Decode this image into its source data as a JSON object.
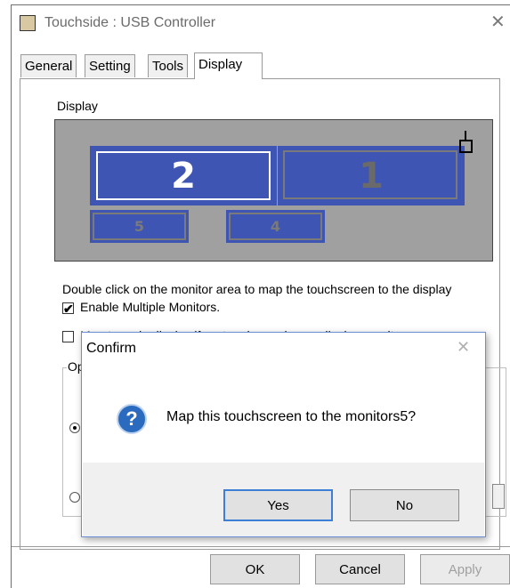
{
  "window": {
    "title": "Touchside : USB Controller",
    "close_glyph": "✕",
    "icon": "app-icon"
  },
  "tabs": [
    {
      "label": "General",
      "active": false
    },
    {
      "label": "Setting",
      "active": false
    },
    {
      "label": "Tools",
      "active": false
    },
    {
      "label": "Display",
      "active": true
    }
  ],
  "display": {
    "group_label": "Display",
    "monitors": [
      {
        "number": "2",
        "selected": true
      },
      {
        "number": "1",
        "selected": false
      },
      {
        "number": "5",
        "selected": false
      },
      {
        "number": "4",
        "selected": false
      }
    ],
    "instruction": "Double click on the monitor area to map the touchscreen to the display",
    "enable_multiple": {
      "label": "Enable Multiple Monitors.",
      "checked": true,
      "mark": "✔"
    },
    "map_main": {
      "label": "Map to main display if system has only one display monitor",
      "checked": false
    },
    "options_group_label": "Op"
  },
  "footer": {
    "ok": "OK",
    "cancel": "Cancel",
    "apply": "Apply"
  },
  "dialog": {
    "title": "Confirm",
    "close_glyph": "✕",
    "icon_glyph": "?",
    "message": "Map this touchscreen to the monitors5?",
    "yes": "Yes",
    "no": "No"
  },
  "colors": {
    "monitor_fill": "#3f55b4",
    "monitor_area": "#a0a0a0",
    "question_icon": "#2a6bc0",
    "focus_border": "#3c7fd6"
  }
}
